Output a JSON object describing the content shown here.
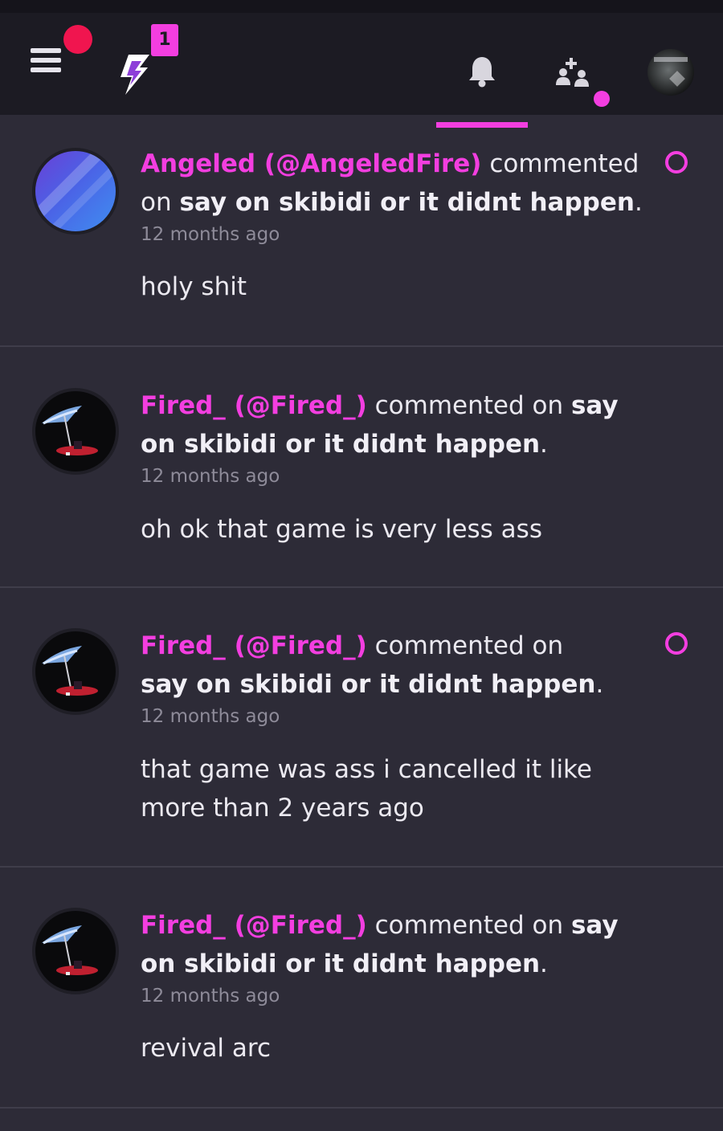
{
  "topbar": {
    "badge_count": "1",
    "active_tab": "notifications",
    "accent_color": "#f33ee0"
  },
  "notifications": [
    {
      "user": "Angeled (@AngeledFire)",
      "action": "commented on",
      "post": "say on skibidi or it didnt happen",
      "punct": ".",
      "time": "12 months ago",
      "body": "holy shit",
      "unread": true
    },
    {
      "user": "Fired_ (@Fired_)",
      "action": "commented on",
      "post": "say on skibidi or it didnt happen",
      "punct": ".",
      "time": "12 months ago",
      "body": "oh ok that game is very less ass",
      "unread": false
    },
    {
      "user": "Fired_ (@Fired_)",
      "action": "commented on",
      "post": "say on skibidi or it didnt happen",
      "punct": ".",
      "time": "12 months ago",
      "body": "that game was ass i cancelled it like more than 2 years ago",
      "unread": true
    },
    {
      "user": "Fired_ (@Fired_)",
      "action": "commented on",
      "post": "say on skibidi or it didnt happen",
      "punct": ".",
      "time": "12 months ago",
      "body": "revival arc",
      "unread": false
    }
  ]
}
